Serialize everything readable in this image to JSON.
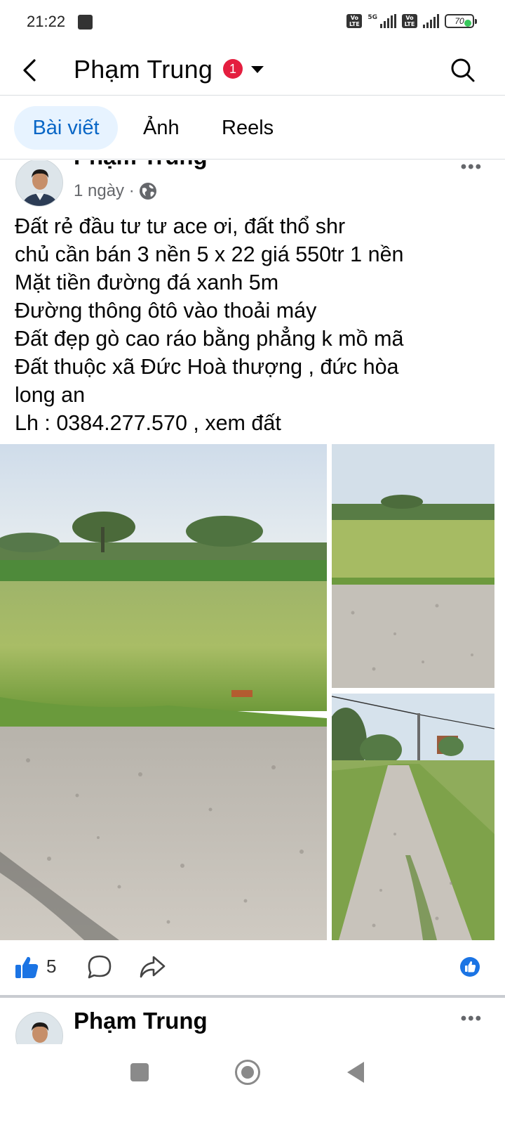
{
  "status_bar": {
    "time": "21:22",
    "network": "5G",
    "volte": "Vo LTE",
    "battery": "70"
  },
  "header": {
    "title": "Phạm Trung",
    "notification_count": "1"
  },
  "tabs": [
    {
      "label": "Bài viết",
      "active": true
    },
    {
      "label": "Ảnh",
      "active": false
    },
    {
      "label": "Reels",
      "active": false
    }
  ],
  "post": {
    "author": "Phạm Trung",
    "time": "1 ngày ·",
    "text_lines": [
      "Đất rẻ đầu tư tư ace ơi, đất thổ shr",
      "chủ cần bán 3 nền 5 x 22 giá 550tr 1 nền",
      "Mặt tiền đường đá xanh 5m",
      "Đường thông ôtô vào thoải máy",
      "Đất đẹp gò cao ráo bằng phẳng k mồ mã",
      "Đất thuộc xã Đức Hoà thượng , đức hòa",
      "long an",
      "Lh : 0384.277.570 , xem đất"
    ],
    "like_count": "5"
  },
  "next_post": {
    "author": "Phạm Trung"
  },
  "colors": {
    "accent": "#0866c6",
    "tab_active_bg": "#e7f3ff",
    "badge": "#e41e3f",
    "like_blue": "#1b74e4"
  }
}
